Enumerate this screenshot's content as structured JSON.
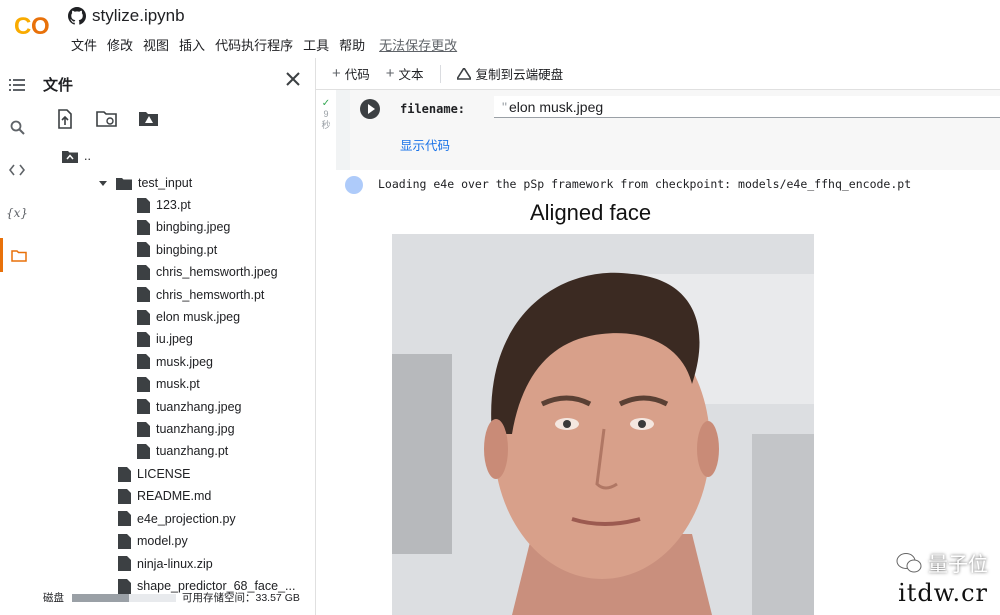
{
  "app": {
    "logo": "CO",
    "doc_title": "stylize.ipynb",
    "github_icon": "github-icon",
    "colors": {
      "logo_orange": "#f9ab00",
      "logo_dark": "#e8710a",
      "accent": "#e8710a",
      "link": "#1a73e8"
    }
  },
  "menu": {
    "items": [
      "文件",
      "修改",
      "视图",
      "插入",
      "代码执行程序",
      "工具",
      "帮助"
    ],
    "unsaved": "无法保存更改"
  },
  "rail": {
    "icons": [
      "toc-icon",
      "search-icon",
      "code-icon",
      "variables-icon",
      "folder-icon"
    ],
    "variables_label": "{x}"
  },
  "files_panel": {
    "title": "文件",
    "tools": [
      "upload-file-icon",
      "refresh-folder-icon",
      "drive-folder-icon"
    ],
    "parent_label": "..",
    "folder": "test_input",
    "folder_files": [
      "123.pt",
      "bingbing.jpeg",
      "bingbing.pt",
      "chris_hemsworth.jpeg",
      "chris_hemsworth.pt",
      "elon musk.jpeg",
      "iu.jpeg",
      "musk.jpeg",
      "musk.pt",
      "tuanzhang.jpeg",
      "tuanzhang.jpg",
      "tuanzhang.pt"
    ],
    "root_files": [
      "LICENSE",
      "README.md",
      "e4e_projection.py",
      "model.py",
      "ninja-linux.zip",
      "shape_predictor_68_face_..."
    ],
    "disk_label": "磁盘",
    "disk_available": "可用存储空间：33.57 GB",
    "disk_used_fraction": 0.55
  },
  "toolbar": {
    "add_code": "代码",
    "add_text": "文本",
    "copy_drive": "复制到云端硬盘"
  },
  "cell": {
    "exec_count": "9",
    "exec_unit": "秒",
    "param_name": "filename:",
    "param_value": "elon musk.jpeg",
    "show_code": "显示代码"
  },
  "output": {
    "log": "Loading e4e over the pSp framework from checkpoint: models/e4e_ffhq_encode.pt",
    "figure_title": "Aligned face"
  },
  "watermark": {
    "top": "量子位",
    "bottom": "itdw.cr"
  }
}
